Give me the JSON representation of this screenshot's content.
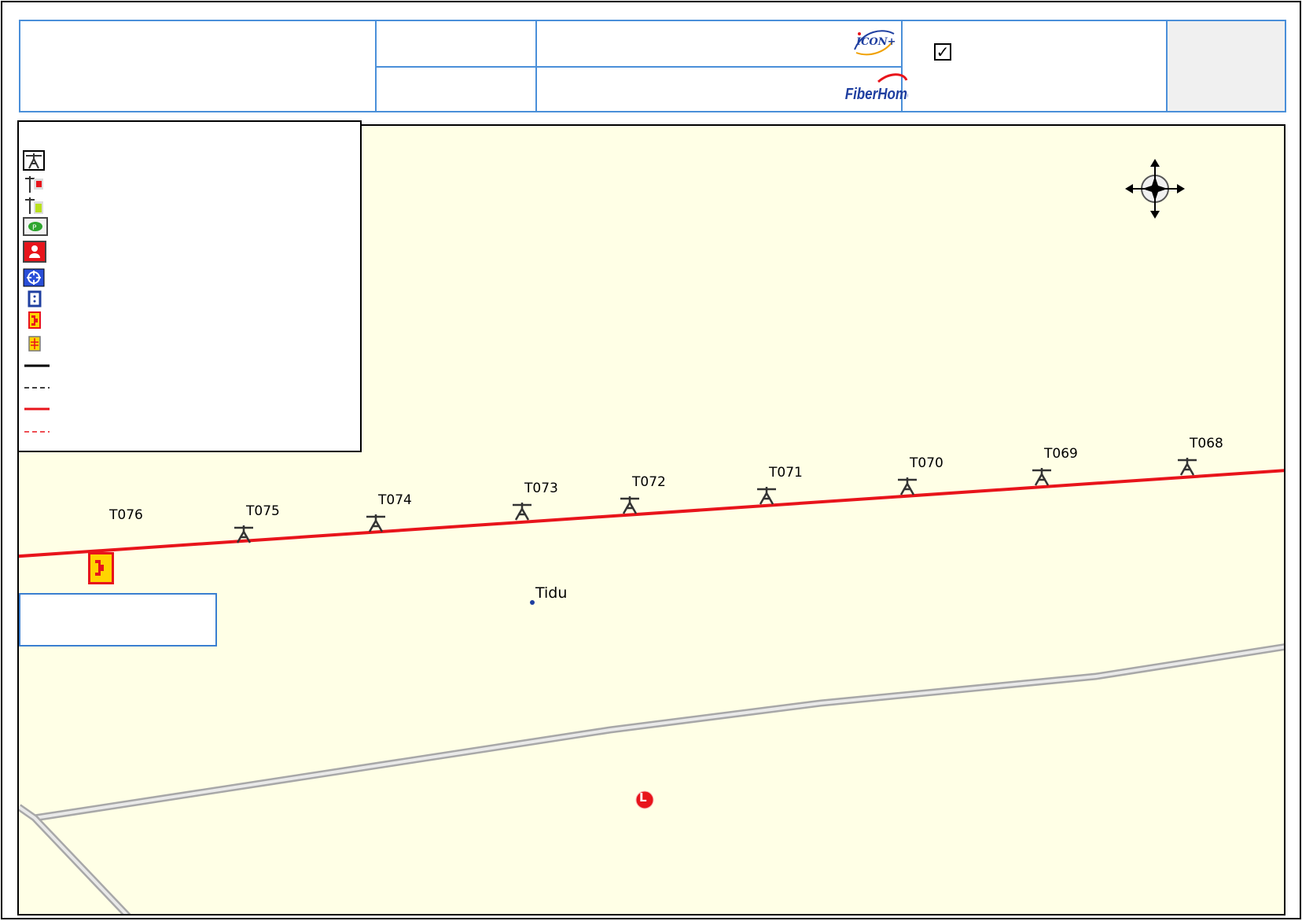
{
  "title_block": {
    "cell_1": "",
    "cell_2_top": "",
    "cell_2_bottom": "",
    "cell_3_top": "",
    "cell_3_bottom": "",
    "cell_4": "",
    "checkbox_mark": "✓",
    "cell_5": "",
    "logos": [
      "icon-plus-logo",
      "fiberhome-logo"
    ]
  },
  "legend": {
    "items": [
      {
        "icon": "tower-symbol-icon"
      },
      {
        "icon": "pole-red-box-icon"
      },
      {
        "icon": "pole-green-box-icon"
      },
      {
        "icon": "green-oval-marker-icon"
      },
      {
        "icon": "red-person-marker-icon"
      },
      {
        "icon": "blue-target-marker-icon"
      },
      {
        "icon": "blue-square-marker-icon"
      },
      {
        "icon": "red-yellow-joint-box-icon"
      },
      {
        "icon": "yellow-grid-box-icon"
      },
      {
        "icon": "black-solid-line-icon"
      },
      {
        "icon": "black-dashed-line-icon"
      },
      {
        "icon": "red-solid-line-icon"
      },
      {
        "icon": "red-dashed-line-icon"
      }
    ]
  },
  "map": {
    "towers": [
      {
        "label": "T076"
      },
      {
        "label": "T075"
      },
      {
        "label": "T074"
      },
      {
        "label": "T073"
      },
      {
        "label": "T072"
      },
      {
        "label": "T071"
      },
      {
        "label": "T070"
      },
      {
        "label": "T069"
      },
      {
        "label": "T068"
      }
    ],
    "place_label": "Tidu",
    "marker_letter": "L",
    "info_box_text": "",
    "colors": {
      "background": "#ffffe6",
      "cable_route": "#e8141b",
      "road": "#b5b5b5",
      "frame_blue": "#4a8fd9"
    }
  }
}
